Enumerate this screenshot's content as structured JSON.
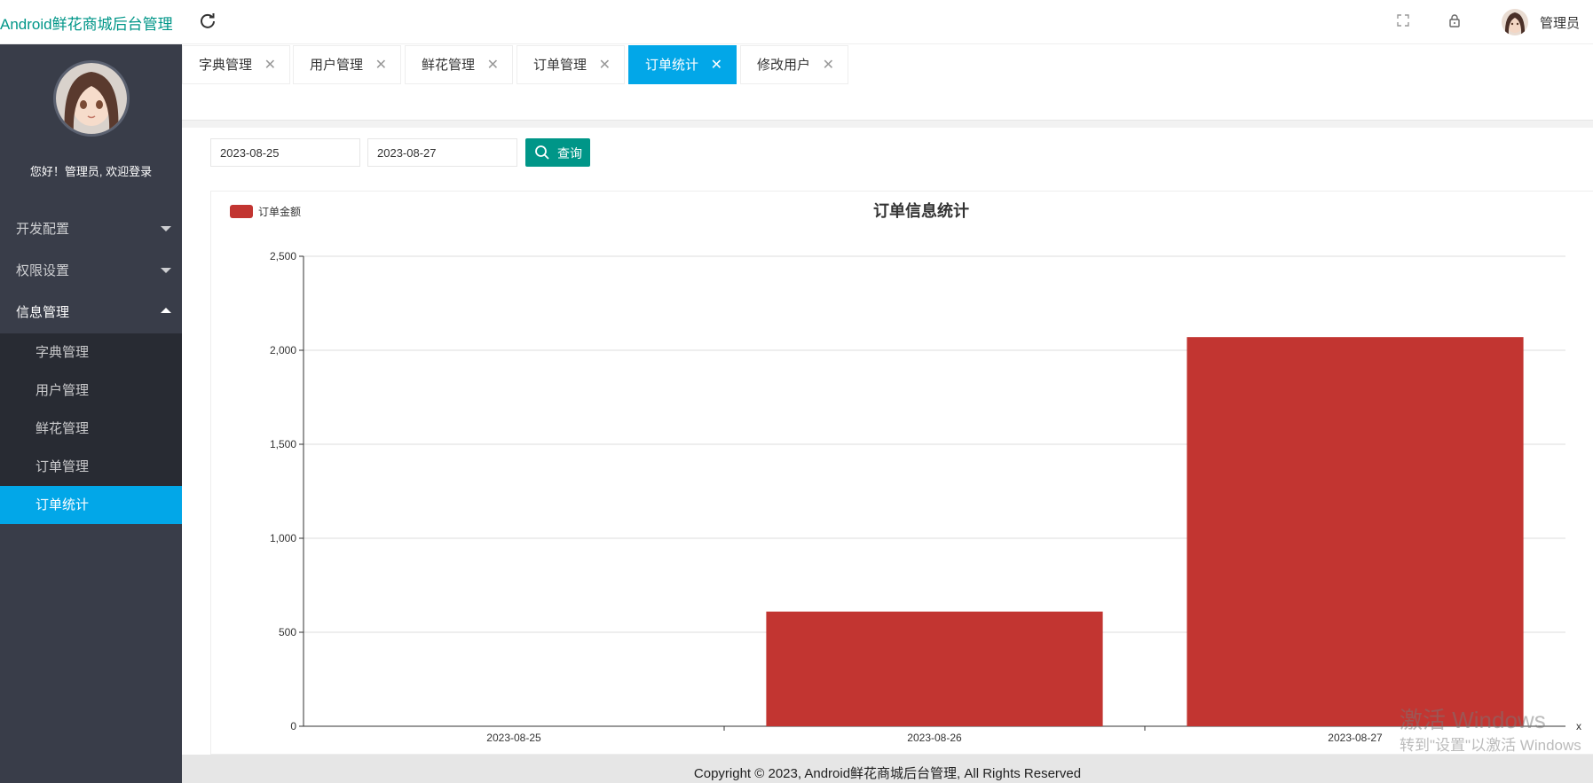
{
  "app": {
    "title": "Android鲜花商城后台管理"
  },
  "header": {
    "user_name": "管理员",
    "icons": [
      "refresh-icon",
      "fullscreen-icon",
      "lock-icon"
    ]
  },
  "sidebar": {
    "welcome": "您好！管理员, 欢迎登录",
    "menu": [
      {
        "label": "开发配置",
        "state": "collapsed"
      },
      {
        "label": "权限设置",
        "state": "collapsed"
      },
      {
        "label": "信息管理",
        "state": "expanded",
        "children": [
          {
            "label": "字典管理"
          },
          {
            "label": "用户管理"
          },
          {
            "label": "鲜花管理"
          },
          {
            "label": "订单管理"
          },
          {
            "label": "订单统计",
            "active": true
          }
        ]
      }
    ]
  },
  "tabs": [
    {
      "label": "字典管理"
    },
    {
      "label": "用户管理"
    },
    {
      "label": "鲜花管理"
    },
    {
      "label": "订单管理"
    },
    {
      "label": "订单统计",
      "active": true
    },
    {
      "label": "修改用户"
    }
  ],
  "filters": {
    "start_date": "2023-08-25",
    "end_date": "2023-08-27",
    "search_label": "查询"
  },
  "chart_data": {
    "type": "bar",
    "title": "订单信息统计",
    "legend": [
      "订单金额"
    ],
    "legend_position": "top-left",
    "categories": [
      "2023-08-25",
      "2023-08-26",
      "2023-08-27"
    ],
    "series": [
      {
        "name": "订单金额",
        "values": [
          0,
          610,
          2070
        ],
        "color": "#c23531"
      }
    ],
    "xlabel": "x",
    "ylabel": "",
    "ylim": [
      0,
      2500
    ],
    "yticks": [
      0,
      500,
      1000,
      1500,
      2000,
      2500
    ],
    "ytick_labels": [
      "0",
      "500",
      "1,000",
      "1,500",
      "2,000",
      "2,500"
    ],
    "grid": true
  },
  "footer": {
    "copyright": "Copyright © 2023, Android鲜花商城后台管理, All Rights Reserved"
  },
  "watermark": {
    "line1": "激活 Windows",
    "line2": "转到\"设置\"以激活 Windows"
  },
  "colors": {
    "accent": "#009688",
    "active_tab": "#02a7e8",
    "sidebar": "#393d49",
    "bar": "#c23531"
  }
}
